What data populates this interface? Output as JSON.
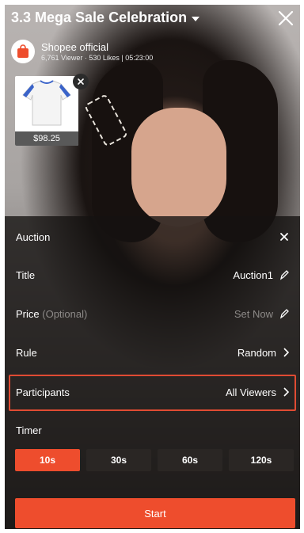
{
  "header": {
    "title": "3.3 Mega Sale Celebration",
    "host_name": "Shopee official",
    "host_stats": "6,761 Viewer · 530 Likes | 05:23:00"
  },
  "product": {
    "price": "$98.25"
  },
  "auction_panel": {
    "title": "Auction",
    "rows": [
      {
        "label": "Title",
        "value": "Auction1"
      },
      {
        "label": "Price",
        "label_suffix": "(Optional)",
        "value": "Set Now"
      },
      {
        "label": "Rule",
        "value": "Random"
      },
      {
        "label": "Participants",
        "value": "All Viewers"
      }
    ],
    "timer_label": "Timer",
    "timer_options": [
      "10s",
      "30s",
      "60s",
      "120s"
    ],
    "timer_selected": "10s",
    "start_label": "Start"
  },
  "colors": {
    "accent": "#ee4d2d",
    "panel": "#141211",
    "muted": "#8d8a88"
  },
  "icons": [
    "chevron-down-icon",
    "close-icon",
    "shopee-bag-icon",
    "pencil-icon",
    "chevron-right-icon"
  ]
}
